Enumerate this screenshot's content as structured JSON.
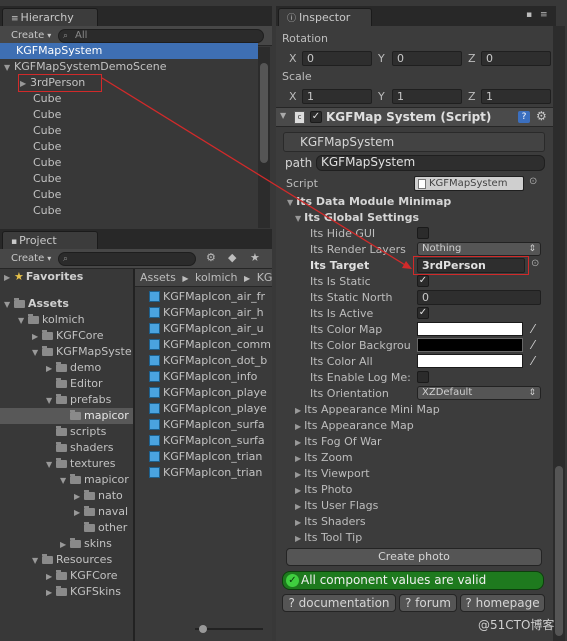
{
  "hierarchy": {
    "tab": "Hierarchy",
    "create": "Create",
    "search_placeholder": "All",
    "items": [
      "KGFMapSystem",
      "KGFMapSystemDemoScene",
      "3rdPerson",
      "Cube",
      "Cube",
      "Cube",
      "Cube",
      "Cube",
      "Cube",
      "Cube",
      "Cube"
    ]
  },
  "project": {
    "tab": "Project",
    "create": "Create",
    "tree": {
      "favorites": "Favorites",
      "assets": "Assets",
      "kolmich": "kolmich",
      "kgfcore": "KGFCore",
      "kgfmapsystem": "KGFMapSyste",
      "demo": "demo",
      "editor": "Editor",
      "prefabs": "prefabs",
      "mapicon": "mapicor",
      "scripts": "scripts",
      "shaders": "shaders",
      "textures": "textures",
      "mapicon2": "mapicor",
      "nato": "nato",
      "naval": "naval",
      "other": "other",
      "skins": "skins",
      "resources": "Resources",
      "kgfcore2": "KGFCore",
      "kgfskins": "KGFSkins"
    },
    "breadcrumb": [
      "Assets",
      "kolmich",
      "KG"
    ],
    "files": [
      "KGFMapIcon_air_fr",
      "KGFMapIcon_air_h",
      "KGFMapIcon_air_u",
      "KGFMapIcon_comm",
      "KGFMapIcon_dot_b",
      "KGFMapIcon_info",
      "KGFMapIcon_playe",
      "KGFMapIcon_playe",
      "KGFMapIcon_surfa",
      "KGFMapIcon_surfa",
      "KGFMapIcon_trian",
      "KGFMapIcon_trian"
    ]
  },
  "inspector": {
    "tab": "Inspector",
    "rotation_label": "Rotation",
    "rotation": {
      "x": "0",
      "y": "0",
      "z": "0"
    },
    "scale_label": "Scale",
    "scale": {
      "x": "1",
      "y": "1",
      "z": "1"
    },
    "axis": {
      "x": "X",
      "y": "Y",
      "z": "Z"
    },
    "component_title": "KGFMap System (Script)",
    "object_name": "KGFMapSystem",
    "path_label": "path",
    "path_value": "KGFMapSystem",
    "script_label": "Script",
    "script_value": "KGFMapSystem",
    "module_title": "Its Data Module Minimap",
    "global_settings": "Its Global Settings",
    "props": {
      "hide_gui": "Its Hide GUI",
      "render_layers": "Its Render Layers",
      "render_layers_value": "Nothing",
      "target": "Its Target",
      "target_value": "3rdPerson",
      "is_static": "Its Is Static",
      "static_north": "Its Static North",
      "static_north_value": "0",
      "is_active": "Its Is Active",
      "color_map": "Its Color Map",
      "color_background": "Its Color Backgrou",
      "color_all": "Its Color All",
      "enable_log": "Its Enable Log Me:",
      "orientation": "Its Orientation",
      "orientation_value": "XZDefault"
    },
    "sections": [
      "Its Appearance Mini Map",
      "Its Appearance Map",
      "Its Fog Of War",
      "Its Zoom",
      "Its Viewport",
      "Its Photo",
      "Its User Flags",
      "Its Shaders",
      "Its Tool Tip"
    ],
    "create_photo": "Create photo",
    "status": "All component values are valid",
    "links": [
      "? documentation",
      "? forum",
      "? homepage"
    ]
  },
  "colors": {
    "selection": "#3e6fb3",
    "valid": "#1e7a1e",
    "highlight": "#d12a2a"
  },
  "watermark": "@51CTO博客"
}
